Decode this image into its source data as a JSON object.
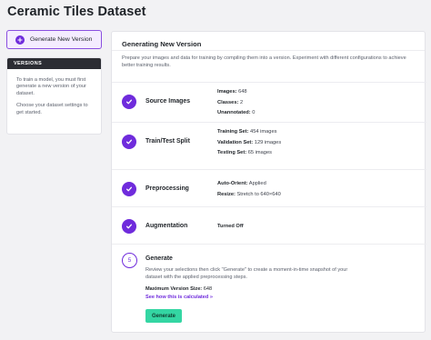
{
  "page": {
    "title": "Ceramic Tiles Dataset"
  },
  "sidebar": {
    "generate_button_label": "Generate New Version",
    "versions_header": "VERSIONS",
    "paragraph_1": "To train a model, you must first generate a new version of your dataset.",
    "paragraph_2": "Choose your dataset settings to get started."
  },
  "main": {
    "title": "Generating New Version",
    "description": "Prepare your images and data for training by compiling them into a version. Experiment with different configurations to achieve better training results.",
    "steps": [
      {
        "label": "Source Images",
        "details": [
          {
            "key": "Images:",
            "value": "648"
          },
          {
            "key": "Classes:",
            "value": "2"
          },
          {
            "key": "Unannotated:",
            "value": "0"
          }
        ]
      },
      {
        "label": "Train/Test Split",
        "details": [
          {
            "key": "Training Set:",
            "value": "454 images"
          },
          {
            "key": "Validation Set:",
            "value": "129 images"
          },
          {
            "key": "Testing Set:",
            "value": "65 images"
          }
        ]
      },
      {
        "label": "Preprocessing",
        "details": [
          {
            "key": "Auto-Orient:",
            "value": "Applied"
          },
          {
            "key": "Resize:",
            "value": "Stretch to 640×640"
          }
        ]
      },
      {
        "label": "Augmentation",
        "details": [
          {
            "key": "Turned Off",
            "value": ""
          }
        ]
      }
    ],
    "generate": {
      "step_number": "5",
      "title": "Generate",
      "description": "Review your selections then click \"Generate\" to create a moment-in-time snapshot of your dataset with the applied preprocessing steps.",
      "size_label": "Maximum Version Size:",
      "size_value": "648",
      "link_text": "See how this is calculated »",
      "button_label": "Generate"
    }
  },
  "colors": {
    "accent": "#6f2bdc",
    "generate_button": "#34d6a3",
    "versions_header_bg": "#2c2d33"
  }
}
